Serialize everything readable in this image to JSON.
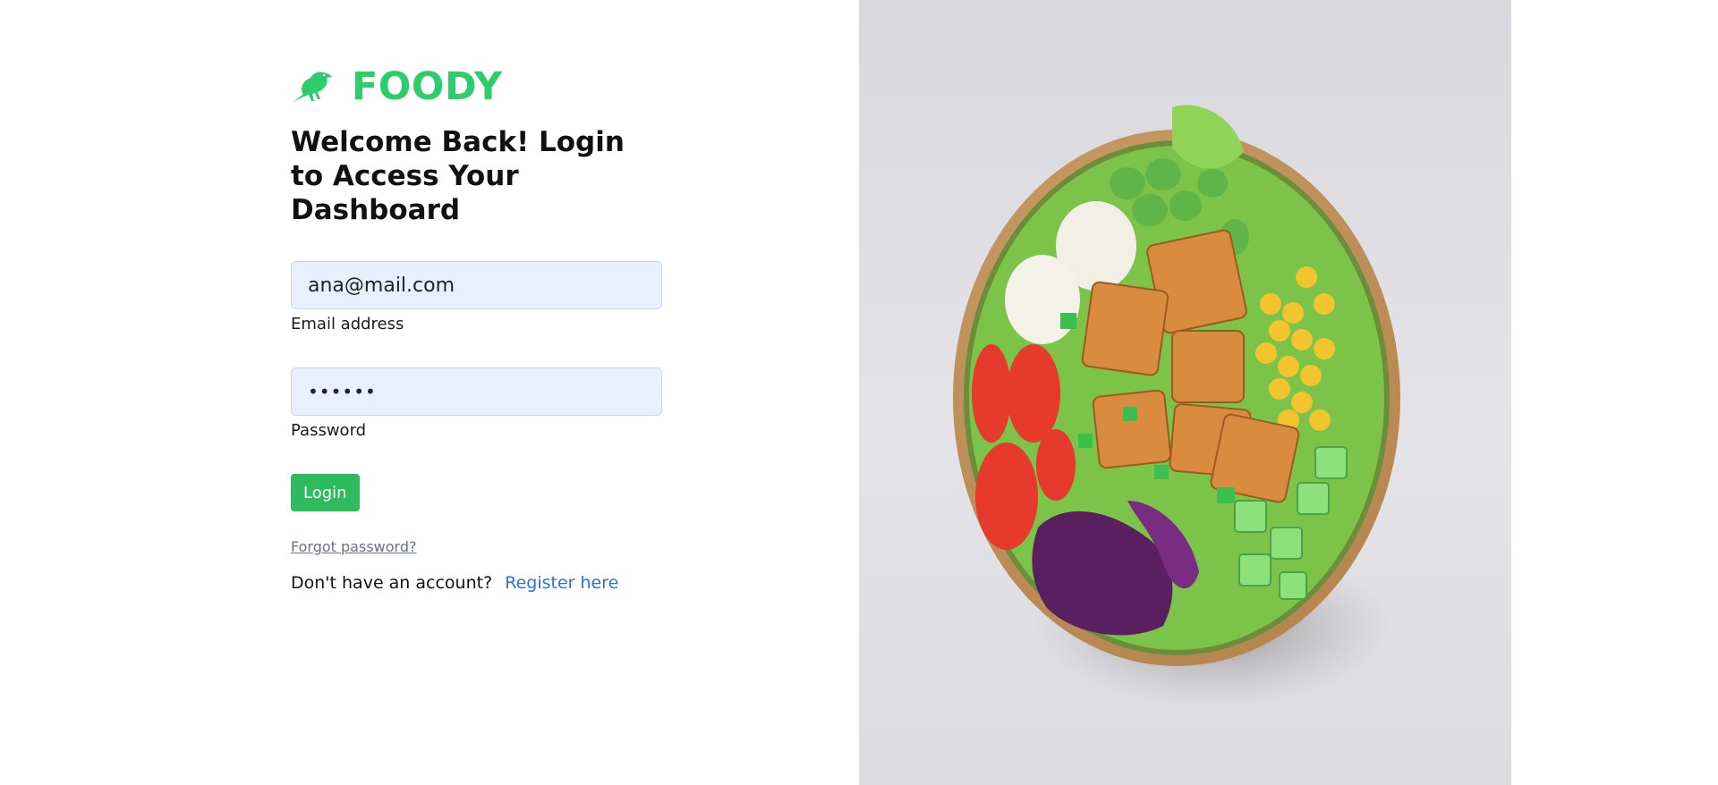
{
  "brand": {
    "name": "FOODY",
    "logo_icon": "bird-icon",
    "color": "#2ecc6a"
  },
  "heading": "Welcome Back! Login to Access Your Dashboard",
  "email": {
    "value": "ana@mail.com",
    "label": "Email address"
  },
  "password": {
    "value": "••••••",
    "label": "Password"
  },
  "login_button": "Login",
  "forgot_link": "Forgot password?",
  "register": {
    "prompt": "Don't have an account?",
    "link": "Register here"
  },
  "hero_image": "salad-bowl-image",
  "colors": {
    "accent": "#2dbb5d",
    "link": "#2f6fdf",
    "input_bg": "#e8f0fd"
  }
}
